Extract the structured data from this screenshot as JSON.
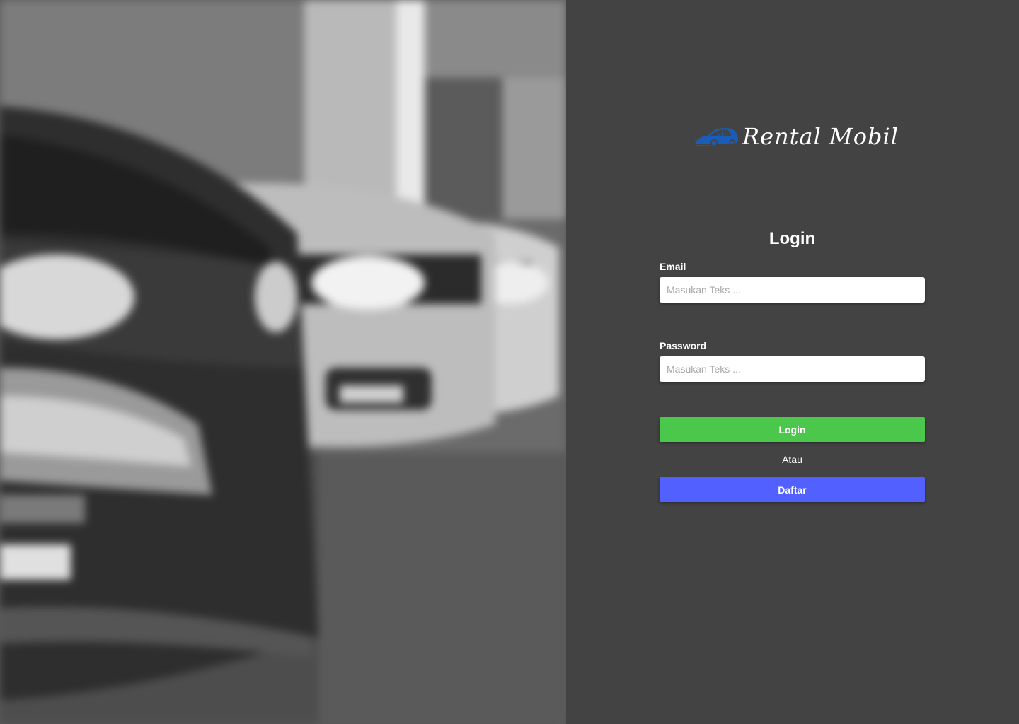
{
  "brand": {
    "name": "Rental Mobil",
    "logo_icon": "car-icon",
    "logo_color": "#1a5db8"
  },
  "login_form": {
    "title": "Login",
    "email": {
      "label": "Email",
      "placeholder": "Masukan Teks ..."
    },
    "password": {
      "label": "Password",
      "placeholder": "Masukan Teks ..."
    },
    "login_button": "Login",
    "divider_text": "Atau",
    "register_button": "Daftar"
  },
  "colors": {
    "panel_background": "#434343",
    "login_button": "#4bc84b",
    "register_button": "#5260ff"
  }
}
